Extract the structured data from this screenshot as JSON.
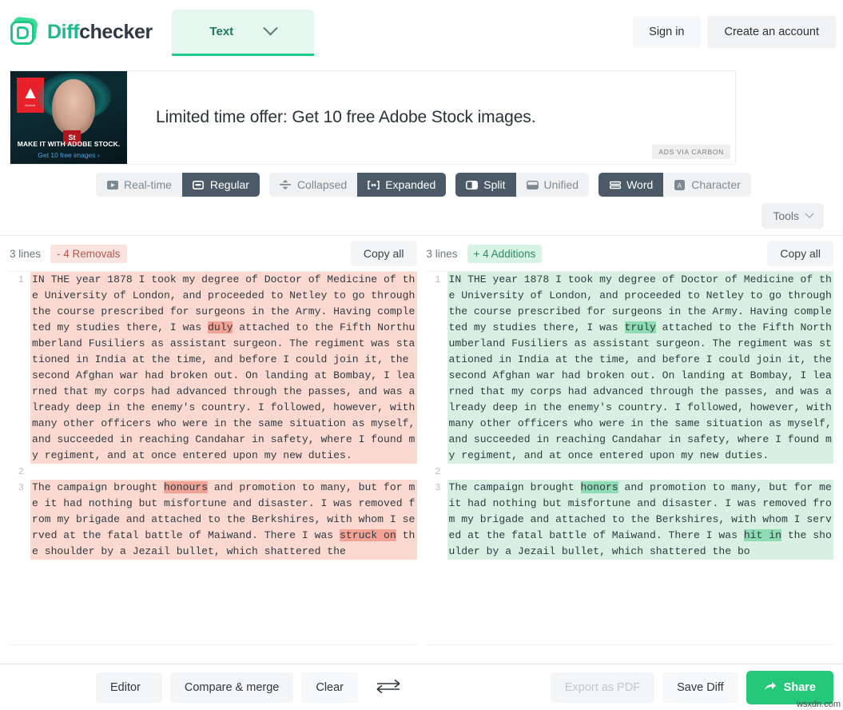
{
  "header": {
    "brand_diff": "Diff",
    "brand_checker": "checker",
    "type_tab_label": "Text",
    "sign_in_label": "Sign in",
    "create_account_label": "Create an account"
  },
  "ad": {
    "headline": "Limited time offer: Get 10 free Adobe Stock images.",
    "badge": "ADS VIA CARBON",
    "image_line1": "MAKE IT WITH ADOBE STOCK.",
    "image_line2": "Get 10 free images ›",
    "image_stock_tag": "St",
    "image_adobe_word": "Adobe"
  },
  "toolbar": {
    "groups": [
      {
        "name": "update-mode",
        "options": [
          {
            "label": "Real-time",
            "icon": "play-icon",
            "active": false
          },
          {
            "label": "Regular",
            "icon": "rectangle-icon",
            "active": true
          }
        ]
      },
      {
        "name": "fold-mode",
        "options": [
          {
            "label": "Collapsed",
            "icon": "collapse-icon",
            "active": false
          },
          {
            "label": "Expanded",
            "icon": "expand-icon",
            "active": true
          }
        ]
      },
      {
        "name": "view-mode",
        "options": [
          {
            "label": "Split",
            "icon": "split-icon",
            "active": true
          },
          {
            "label": "Unified",
            "icon": "unified-icon",
            "active": false
          }
        ]
      },
      {
        "name": "granularity",
        "options": [
          {
            "label": "Word",
            "icon": "word-icon",
            "active": true
          },
          {
            "label": "Character",
            "icon": "character-icon",
            "active": false
          }
        ]
      }
    ],
    "tools_label": "Tools"
  },
  "stats": {
    "left": {
      "lines": "3 lines",
      "change_chip": "- 4 Removals",
      "copy_all": "Copy all"
    },
    "right": {
      "lines": "3 lines",
      "change_chip": "+ 4 Additions",
      "copy_all": "Copy all"
    }
  },
  "diff": {
    "left": {
      "rows": [
        {
          "num": "1",
          "type": "removal",
          "segments": [
            {
              "t": "IN THE year 1878 I took my degree of Doctor of Medicine of the University of London, and proceeded to Netley to go through the course prescribed for surgeons in the Army. Having completed my studies there, I was ",
              "h": false
            },
            {
              "t": "duly",
              "h": true
            },
            {
              "t": " attached to the Fifth Northumberland Fusiliers as assistant surgeon. The regiment was stationed in India at the time, and before I could join it, the second Afghan war had broken out. On landing at Bombay, I learned that my corps had advanced through the passes, and was already deep in the enemy's country. I followed, however, with many other officers who were in the same situation as myself, and succeeded in reaching Candahar in safety, where I found my regiment, and at once entered upon my new duties.",
              "h": false
            }
          ]
        },
        {
          "num": "2",
          "type": "neutral",
          "segments": [
            {
              "t": "",
              "h": false
            }
          ]
        },
        {
          "num": "3",
          "type": "removal",
          "segments": [
            {
              "t": "The campaign brought ",
              "h": false
            },
            {
              "t": "honours",
              "h": true
            },
            {
              "t": " and promotion to many, but for me it had nothing but misfortune and disaster. I was removed from my brigade and attached to the Berkshires, with whom I served at the fatal battle of Maiwand. There I was ",
              "h": false
            },
            {
              "t": "struck on",
              "h": true
            },
            {
              "t": " the shoulder by a Jezail bullet, which shattered the",
              "h": false
            }
          ]
        }
      ]
    },
    "right": {
      "rows": [
        {
          "num": "1",
          "type": "addition",
          "segments": [
            {
              "t": "IN THE year 1878 I took my degree of Doctor of Medicine of the University of London, and proceeded to Netley to go through the course prescribed for surgeons in the Army. Having completed my studies there, I was ",
              "h": false
            },
            {
              "t": "truly",
              "h": true
            },
            {
              "t": " attached to the Fifth Northumberland Fusiliers as assistant surgeon. The regiment was stationed in India at the time, and before I could join it, the second Afghan war had broken out. On landing at Bombay, I learned that my corps had advanced through the passes, and was already deep in the enemy's country. I followed, however, with many other officers who were in the same situation as myself, and succeeded in reaching Candahar in safety, where I found my regiment, and at once entered upon my new duties.",
              "h": false
            }
          ]
        },
        {
          "num": "2",
          "type": "neutral",
          "segments": [
            {
              "t": "",
              "h": false
            }
          ]
        },
        {
          "num": "3",
          "type": "addition",
          "segments": [
            {
              "t": "The campaign brought ",
              "h": false
            },
            {
              "t": "honors",
              "h": true
            },
            {
              "t": " and promotion to many, but for me it had nothing but misfortune and disaster. I was removed from my brigade and attached to the Berkshires, with whom I served at the fatal battle of Maiwand. There I was ",
              "h": false
            },
            {
              "t": "hit in",
              "h": true
            },
            {
              "t": " the shoulder by a Jezail bullet, which shattered the bo",
              "h": false
            }
          ]
        }
      ]
    }
  },
  "footer": {
    "editor_label": "Editor",
    "compare_merge_label": "Compare & merge",
    "clear_label": "Clear",
    "swap_icon": "swap-arrows-icon",
    "export_pdf_label": "Export as PDF",
    "save_diff_label": "Save Diff",
    "share_label": "Share"
  },
  "watermark": "wsxdn.com",
  "colors": {
    "brand_green": "#22b98a",
    "share_green": "#24c878",
    "active_slate": "#4c5a68",
    "removal_bg": "#fbd9d0",
    "removal_hl": "#f3a293",
    "addition_bg": "#d8f0e2",
    "addition_hl": "#8ddcb4"
  }
}
